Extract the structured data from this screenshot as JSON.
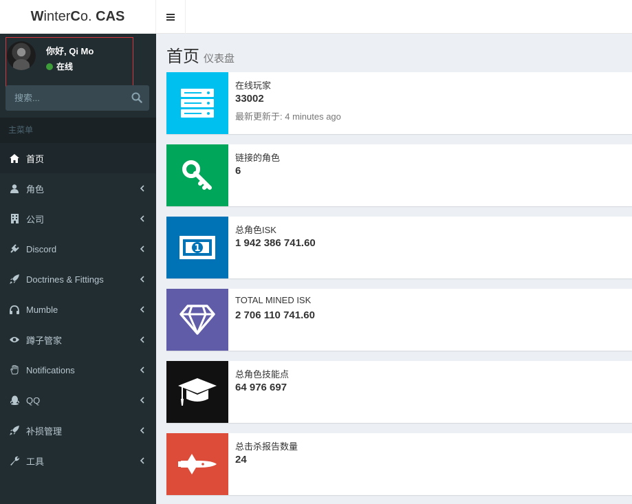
{
  "logo": {
    "bold1": "W",
    "mid": "inter",
    "bold2": "C",
    "rest": "o. ",
    "bold3": "CAS"
  },
  "user": {
    "greeting": "你好, Qi Mo",
    "status": "在线"
  },
  "search": {
    "placeholder": "搜索..."
  },
  "menu_header": "主菜单",
  "menu": [
    {
      "label": "首页",
      "icon": "home-icon"
    },
    {
      "label": "角色",
      "icon": "user-icon"
    },
    {
      "label": "公司",
      "icon": "building-icon"
    },
    {
      "label": "Discord",
      "icon": "plug-icon"
    },
    {
      "label": "Doctrines & Fittings",
      "icon": "rocket-icon"
    },
    {
      "label": "Mumble",
      "icon": "headphones-icon"
    },
    {
      "label": "蹲子管家",
      "icon": "eye-icon"
    },
    {
      "label": "Notifications",
      "icon": "hand-icon"
    },
    {
      "label": "QQ",
      "icon": "qq-icon"
    },
    {
      "label": "补损管理",
      "icon": "rocket-icon"
    },
    {
      "label": "工具",
      "icon": "wrench-icon"
    }
  ],
  "page": {
    "title": "首页",
    "subtitle": "仪表盘"
  },
  "boxes": [
    {
      "label": "在线玩家",
      "value": "33002",
      "desc": "最新更新于: 4 minutes ago",
      "color": "#00c0ef",
      "icon": "server-icon"
    },
    {
      "label": "链接的角色",
      "value": "6",
      "color": "#00a65a",
      "icon": "key-icon"
    },
    {
      "label": "总角色ISK",
      "value": "1 942 386 741.60",
      "color": "#0073b7",
      "icon": "money-icon"
    },
    {
      "label": "TOTAL MINED ISK",
      "value": "2 706 110 741.60",
      "color": "#605ca8",
      "icon": "diamond-icon"
    },
    {
      "label": "总角色技能点",
      "value": "64 976 697",
      "color": "#111111",
      "icon": "graduation-cap-icon"
    },
    {
      "label": "总击杀报告数量",
      "value": "24",
      "color": "#dd4b39",
      "icon": "space-shuttle-icon"
    }
  ]
}
